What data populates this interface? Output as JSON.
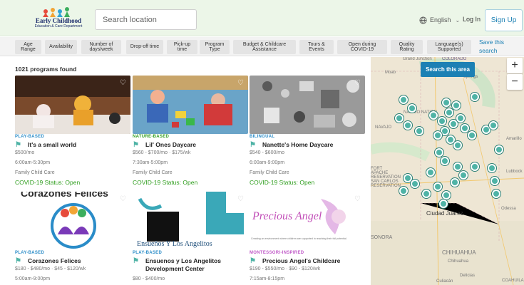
{
  "header": {
    "logo": {
      "line1": "New Mexico",
      "line2": "Early Childhood",
      "line3": "Education & Care Department"
    },
    "search_placeholder": "Search location",
    "language": "English",
    "login": "Log In",
    "signup": "Sign Up"
  },
  "filters": [
    "Age Range",
    "Availability",
    "Number of days/week",
    "Drop-off time",
    "Pick-up time",
    "Program Type",
    "Budget & Childcare Assistance",
    "Tours & Events",
    "Open during COVID-19",
    "Quality Rating",
    "Language(s) Supported"
  ],
  "save_area": "Save this search",
  "results_count": "1021 programs found",
  "cards": [
    {
      "tag": "PLAY-BASED",
      "tag_color": "#2a8cc8",
      "name": "It's a small world",
      "price": "$500/mo",
      "hours": "6:00am-5:30pm",
      "type": "Family Child Care",
      "covid": "COVID-19 Status: Open"
    },
    {
      "tag": "NATURE-BASED",
      "tag_color": "#2f9e1e",
      "name": "Lil' Ones Daycare",
      "price": "$560 - $700/mo · $175/wk",
      "hours": "7:30am-5:00pm",
      "type": "Family Child Care",
      "covid": "COVID-19 Status: Open"
    },
    {
      "tag": "BILINGUAL",
      "tag_color": "#2a8cc8",
      "name": "Nanette's Home Daycare",
      "price": "$540 - $600/mo",
      "hours": "6:00am-9:00pm",
      "type": "Family Child Care",
      "covid": "COVID-19 Status: Open"
    },
    {
      "tag": "PLAY-BASED",
      "tag_color": "#2a8cc8",
      "name": "Corazones Felices",
      "price": "$180 - $480/mo · $45 - $120/wk",
      "hours": "5:00am-9:00pm",
      "img_text": "Corazones Felices"
    },
    {
      "tag": "PLAY-BASED",
      "tag_color": "#2a8cc8",
      "name": "Ensuenos y Los Angelitos Development Center",
      "price": "$80 - $400/mo",
      "img_text": "Ensueños Y Los Angelitos"
    },
    {
      "tag": "MONTESSORI-INSPIRED",
      "tag_color": "#c05ac8",
      "name": "Precious Angel's Childcare",
      "price": "$190 - $550/mo · $90 - $120/wk",
      "hours": "7:15am-8:15pm",
      "img_text": "Precious Angel",
      "img_caption": "Creating an environment where children are supported in reaching their full potential."
    }
  ],
  "map": {
    "button": "Search this area",
    "zoom_in": "+",
    "zoom_out": "−",
    "labels": [
      "Grand Junction",
      "COLORADO",
      "Moab",
      "Springs",
      "NAVAJO NATION",
      "NAVAJO",
      "FORT APACHE RESERVATION",
      "SAN CARLOS RESERVATION",
      "Amarillo",
      "Lubbock",
      "Odessa",
      "Ciudad Juárez",
      "SONORA",
      "CHIHUAHUA",
      "Chihuahua",
      "Delicias",
      "Culiacán",
      "COAHUILA"
    ],
    "pin_color": "#4fb3a6"
  }
}
